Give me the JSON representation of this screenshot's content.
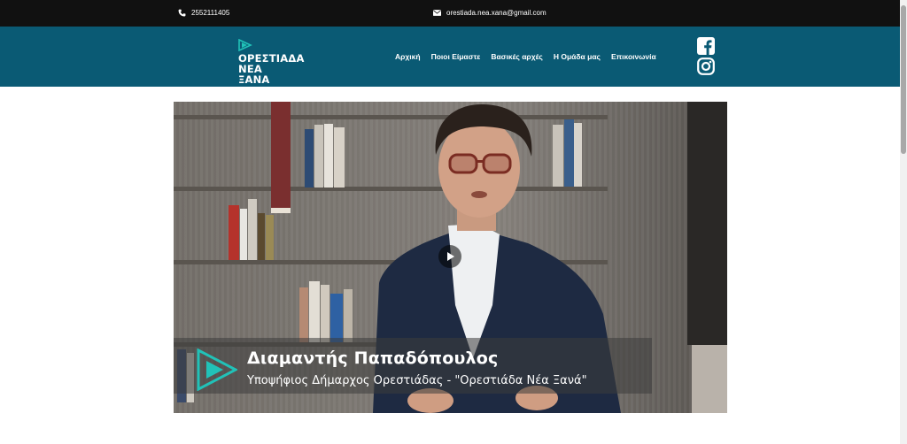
{
  "topbar": {
    "phone": "2552111405",
    "email": "orestiada.nea.xana@gmail.com",
    "phone_icon": "phone-icon",
    "email_icon": "envelope-icon"
  },
  "logo": {
    "line1": "ΟΡΕΣΤΙΑΔΑ",
    "line2": "ΝΕΑ ΞΑΝΑ",
    "accent": "#21c2b8"
  },
  "nav": {
    "items": [
      "Αρχική",
      "Ποιοι Είμαστε",
      "Βασικές αρχές",
      "Η Ομάδα μας",
      "Επικοινωνία"
    ]
  },
  "social": {
    "icons": [
      "facebook-icon",
      "instagram-icon"
    ]
  },
  "video": {
    "name": "Διαμαντής Παπαδόπουλος",
    "subtitle": "Υποψήφιος Δήμαρχος Ορεστιάδας  - \"Ορεστιάδα Νέα Ξανά\"",
    "play_icon": "play-icon"
  },
  "colors": {
    "topbar": "#111111",
    "navbar": "#0a5a74",
    "accent": "#21c2b8"
  }
}
